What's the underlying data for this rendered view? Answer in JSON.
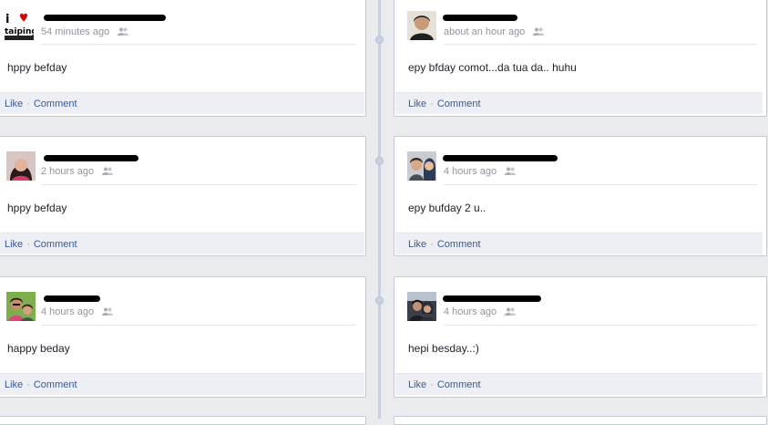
{
  "posts": [
    {
      "column": "left",
      "avatar": "i-heart-taiping-avatar",
      "time": "54 minutes ago",
      "message": "hppy befday"
    },
    {
      "column": "right",
      "avatar": "person-avatar",
      "time": "about an hour ago",
      "message": "epy bfday comot...da tua da.. huhu"
    },
    {
      "column": "left",
      "avatar": "person-avatar",
      "time": "2 hours ago",
      "message": "hppy befday"
    },
    {
      "column": "right",
      "avatar": "couple-avatar",
      "time": "4 hours ago",
      "message": "epy bufday 2 u.."
    },
    {
      "column": "left",
      "avatar": "couple-avatar",
      "time": "4 hours ago",
      "message": "happy beday"
    },
    {
      "column": "right",
      "avatar": "couple-avatar",
      "time": "4 hours ago",
      "message": "hepi besday..:)"
    }
  ],
  "footer": {
    "like_label": "Like",
    "separator": "·",
    "comment_label": "Comment"
  },
  "avatar_logo_text": {
    "top": "i",
    "bottom": "taiping"
  },
  "icons": {
    "audience": "friends-icon",
    "heart": "heart-icon"
  },
  "colors": {
    "link": "#3b5998",
    "meta": "#90949c",
    "footer_bg": "#edeff4",
    "page_bg": "#e9ebee"
  }
}
